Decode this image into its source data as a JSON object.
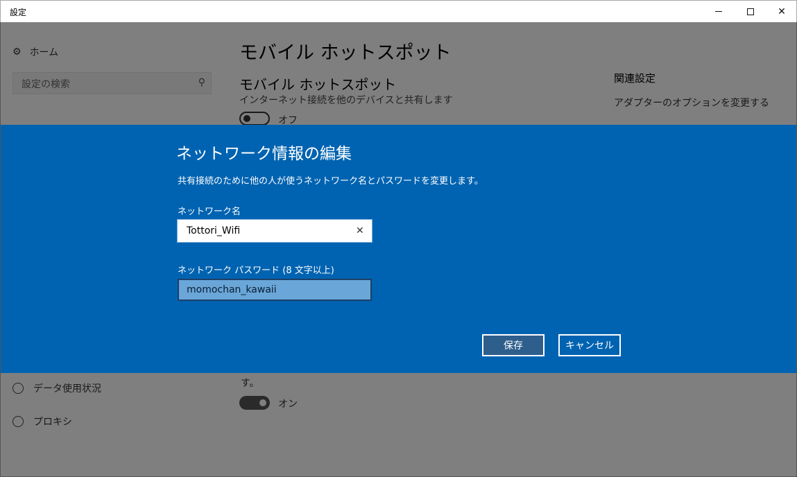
{
  "window": {
    "title": "設定",
    "controls": {
      "minimize": "",
      "maximize": "",
      "close": "✕"
    }
  },
  "sidebar": {
    "home_label": "ホーム",
    "search_placeholder": "設定の検索",
    "items": [
      {
        "label": "データ使用状況",
        "icon": "pie-chart-icon"
      },
      {
        "label": "プロキシ",
        "icon": "globe-icon"
      }
    ]
  },
  "main": {
    "page_title": "モバイル ホットスポット",
    "section_title": "モバイル ホットスポット",
    "section_desc": "インターネット接続を他のデバイスと共有します",
    "toggle_state": "オフ",
    "bottom_text": "す。",
    "bottom_toggle_state": "オン"
  },
  "related": {
    "title": "関連設定",
    "link": "アダプターのオプションを変更する"
  },
  "dialog": {
    "title": "ネットワーク情報の編集",
    "description": "共有接続のために他の人が使うネットワーク名とパスワードを変更します。",
    "name_label": "ネットワーク名",
    "name_value": "Tottori_Wifi",
    "password_label": "ネットワーク パスワード (8 文字以上)",
    "password_value": "momochan_kawaii",
    "save_label": "保存",
    "cancel_label": "キャンセル",
    "colors": {
      "dialog_bg": "#0063b1",
      "save_bg": "#2e5e8c"
    }
  }
}
